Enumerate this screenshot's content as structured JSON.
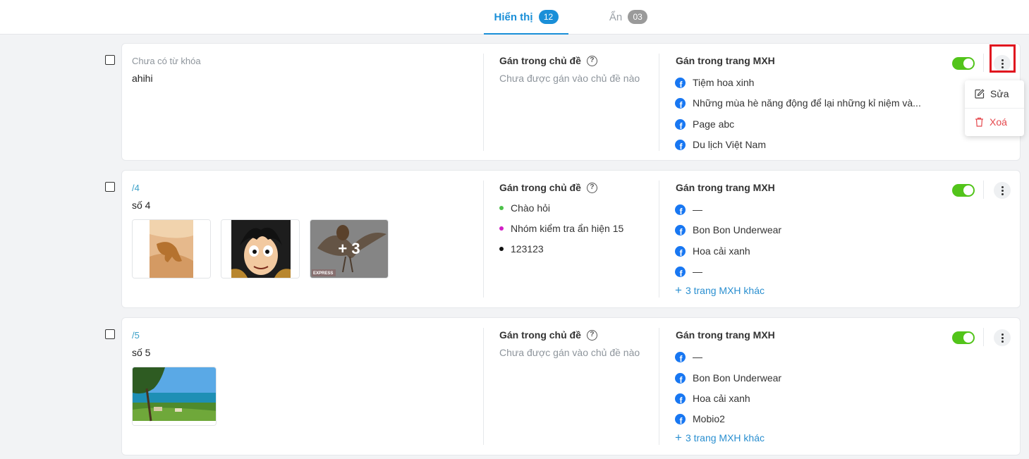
{
  "tabs": [
    {
      "label": "Hiển thị",
      "count": "12"
    },
    {
      "label": "Ẩn",
      "count": "03"
    }
  ],
  "menu": {
    "edit_label": "Sửa",
    "delete_label": "Xoá"
  },
  "cards": [
    {
      "keyword_label": "Chưa có từ khóa",
      "keyword_value": "ahihi",
      "topic_title": "Gán trong chủ đề",
      "topic_help": "?",
      "topic_empty": "Chưa được gán vào chủ đề nào",
      "pages_title": "Gán trong trang MXH",
      "pages": [
        "Tiệm hoa xinh",
        "Những mùa hè năng động để lại những kỉ niệm và...",
        "Page abc",
        "Du lịch Việt Nam"
      ]
    },
    {
      "keyword_label": "/4",
      "keyword_value": "số 4",
      "topic_title": "Gán trong chủ đề",
      "topic_help": "?",
      "topics": [
        {
          "name": "Chào hỏi",
          "color": "#4cc14a"
        },
        {
          "name": "Nhóm kiểm tra ẩn hiện 15",
          "color": "#d21fc5"
        },
        {
          "name": "123123",
          "color": "#111111"
        }
      ],
      "pages_title": "Gán trong trang MXH",
      "pages": [
        "—",
        "Bon Bon Underwear",
        "Hoa cải xanh",
        "—"
      ],
      "more_pages": "3 trang MXH khác",
      "more_images": "+ 3",
      "watermark": "EXPRESS"
    },
    {
      "keyword_label": "/5",
      "keyword_value": "số 5",
      "topic_title": "Gán trong chủ đề",
      "topic_help": "?",
      "topic_empty": "Chưa được gán vào chủ đề nào",
      "pages_title": "Gán trong trang MXH",
      "pages": [
        "—",
        "Bon Bon Underwear",
        "Hoa cải xanh",
        "Mobio2"
      ],
      "more_pages": "3 trang MXH khác"
    }
  ],
  "colors": {
    "accent": "#1a8fd8",
    "toggle_on": "#52c41a",
    "danger": "#e5484d",
    "facebook": "#1877f2",
    "highlight": "#e0141e"
  },
  "icons": {
    "facebook": "facebook-icon",
    "help": "help-circle-icon",
    "edit": "edit-icon",
    "delete": "trash-icon",
    "more": "more-vertical-icon"
  }
}
